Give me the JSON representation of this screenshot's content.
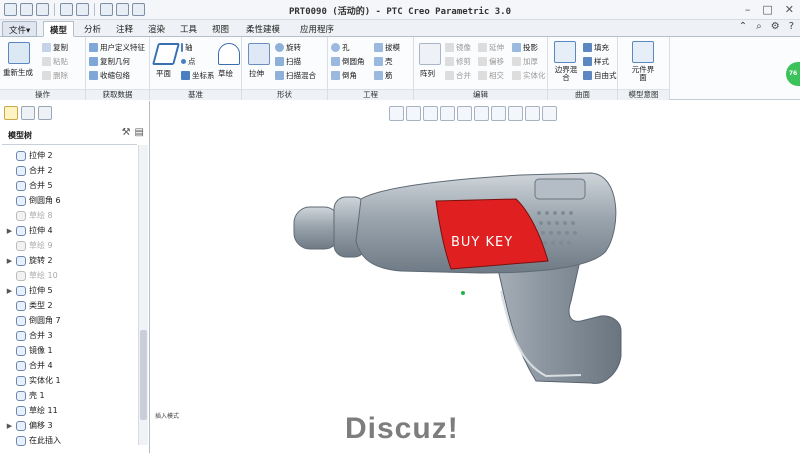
{
  "window": {
    "title": "PRT0090 (活动的) - PTC Creo Parametric 3.0"
  },
  "ribbon_tabs": [
    "文件▾",
    "模型",
    "分析",
    "注释",
    "渲染",
    "工具",
    "视图",
    "柔性建模",
    "应用程序"
  ],
  "active_tab": "模型",
  "ribbon": {
    "regen_label": "重新生成",
    "operations": {
      "copy": "复制",
      "paste": "粘贴",
      "delete": "删除",
      "group": "操作"
    },
    "get_data": {
      "udf": "用户定义特征",
      "copy_geom": "复制几何",
      "shrinkwrap": "收缩包络",
      "group": "获取数据"
    },
    "datum": {
      "plane": "平面",
      "axis": "轴",
      "point": "点",
      "csys": "坐标系",
      "sketch": "草绘",
      "group": "基准"
    },
    "shapes": {
      "extrude": "拉伸",
      "revolve": "旋转",
      "sweep": "扫描",
      "swept_blend": "扫描混合",
      "group": "形状"
    },
    "engineering": {
      "hole": "孔",
      "round": "倒圆角",
      "chamfer": "倒角",
      "draft": "拔模",
      "shell": "壳",
      "rib": "筋",
      "group": "工程"
    },
    "editing": {
      "pattern": "阵列",
      "mirror": "镜像",
      "trim": "修剪",
      "merge": "合并",
      "extend": "延伸",
      "offset": "偏移",
      "intersect": "相交",
      "project": "投影",
      "thicken": "加厚",
      "solidify": "实体化",
      "group": "编辑"
    },
    "surfaces": {
      "boundary_blend": "边界混合",
      "fill": "填充",
      "style": "样式",
      "freeform": "自由式",
      "group": "曲面"
    },
    "model_intent": {
      "component_interface": "元件界面",
      "group": "模型意图"
    }
  },
  "model_tree": {
    "title": "模型树",
    "items": [
      {
        "label": "拉伸 2",
        "expand": "",
        "dim": false
      },
      {
        "label": "合并 2",
        "expand": "",
        "dim": false
      },
      {
        "label": "合并 5",
        "expand": "",
        "dim": false
      },
      {
        "label": "倒圆角 6",
        "expand": "",
        "dim": false
      },
      {
        "label": "草绘 8",
        "expand": "",
        "dim": true
      },
      {
        "label": "拉伸 4",
        "expand": "▶",
        "dim": false
      },
      {
        "label": "草绘 9",
        "expand": "",
        "dim": true
      },
      {
        "label": "旋转 2",
        "expand": "▶",
        "dim": false
      },
      {
        "label": "草绘 10",
        "expand": "",
        "dim": true
      },
      {
        "label": "拉伸 5",
        "expand": "▶",
        "dim": false
      },
      {
        "label": "类型 2",
        "expand": "",
        "dim": false
      },
      {
        "label": "倒圆角 7",
        "expand": "",
        "dim": false
      },
      {
        "label": "合并 3",
        "expand": "",
        "dim": false
      },
      {
        "label": "镜像 1",
        "expand": "",
        "dim": false
      },
      {
        "label": "合并 4",
        "expand": "",
        "dim": false
      },
      {
        "label": "实体化 1",
        "expand": "",
        "dim": false
      },
      {
        "label": "壳 1",
        "expand": "",
        "dim": false
      },
      {
        "label": "草绘 11",
        "expand": "",
        "dim": false
      },
      {
        "label": "偏移 3",
        "expand": "▶",
        "dim": false
      },
      {
        "label": "在此插入",
        "expand": "",
        "dim": false
      }
    ]
  },
  "graphics": {
    "status": "插入模式",
    "decal_text": "BUY  KEY",
    "watermark": "Discuz!"
  },
  "colors": {
    "body": "#9aa4ad",
    "decal": "#e02020",
    "accent": "#2a6ebb"
  }
}
